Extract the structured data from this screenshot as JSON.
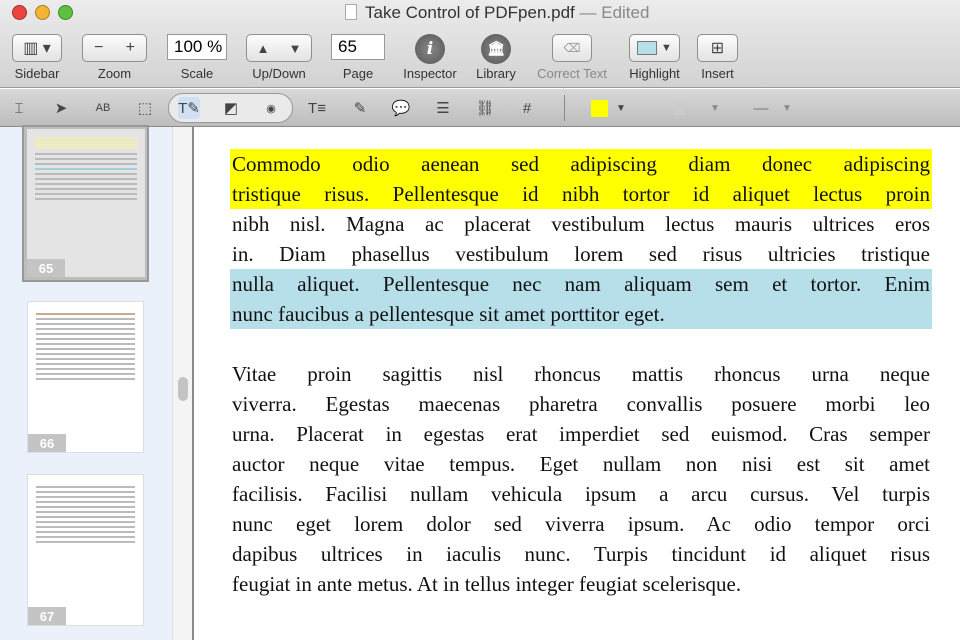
{
  "window": {
    "title": "Take Control of PDFpen.pdf",
    "status": "— Edited"
  },
  "toolbar": {
    "sidebar": "Sidebar",
    "zoom": "Zoom",
    "zoom_out": "−",
    "zoom_in": "+",
    "scale": "Scale",
    "scale_value": "100 %",
    "updown": "Up/Down",
    "page": "Page",
    "page_value": "65",
    "inspector": "Inspector",
    "library": "Library",
    "correct_text": "Correct Text",
    "highlight": "Highlight",
    "insert": "Insert"
  },
  "colors": {
    "highlight_yellow": "#ffff00",
    "highlight_blue": "#b7dfea",
    "fill_color": "#ffff00"
  },
  "thumbnails": [
    {
      "page": "65"
    },
    {
      "page": "66"
    },
    {
      "page": "67"
    }
  ],
  "document": {
    "paragraphs": [
      {
        "lines": [
          {
            "text": "Commodo odio aenean sed adipiscing diam donec adipiscing",
            "hl": "yellow"
          },
          {
            "text": "tristique risus. Pellentesque id nibh tortor id aliquet lectus proin",
            "hl": "yellow"
          },
          {
            "text": "nibh nisl. Magna ac placerat vestibulum lectus mauris ultrices eros",
            "hl": ""
          },
          {
            "text": "in. Diam phasellus vestibulum lorem sed risus ultricies tristique",
            "hl": ""
          },
          {
            "text": "nulla aliquet. Pellentesque nec nam aliquam sem et tortor. Enim",
            "hl": "blue"
          },
          {
            "text": "nunc faucibus a pellentesque sit amet porttitor eget.",
            "hl": "blue"
          }
        ]
      },
      {
        "lines": [
          {
            "text": "Vitae proin sagittis nisl rhoncus mattis rhoncus urna neque",
            "hl": ""
          },
          {
            "text": "viverra. Egestas maecenas pharetra convallis posuere morbi leo",
            "hl": ""
          },
          {
            "text": "urna. Placerat in egestas erat imperdiet sed euismod. Cras semper",
            "hl": ""
          },
          {
            "text": "auctor neque vitae tempus. Eget nullam non nisi est sit amet",
            "hl": ""
          },
          {
            "text": "facilisis. Facilisi nullam vehicula ipsum a arcu cursus. Vel turpis",
            "hl": ""
          },
          {
            "text": "nunc eget lorem dolor sed viverra ipsum. Ac odio tempor orci",
            "hl": ""
          },
          {
            "text": "dapibus ultrices in iaculis nunc. Turpis tincidunt id aliquet risus",
            "hl": ""
          },
          {
            "text": "feugiat in ante metus. At in tellus integer feugiat scelerisque.",
            "hl": ""
          }
        ]
      }
    ]
  }
}
